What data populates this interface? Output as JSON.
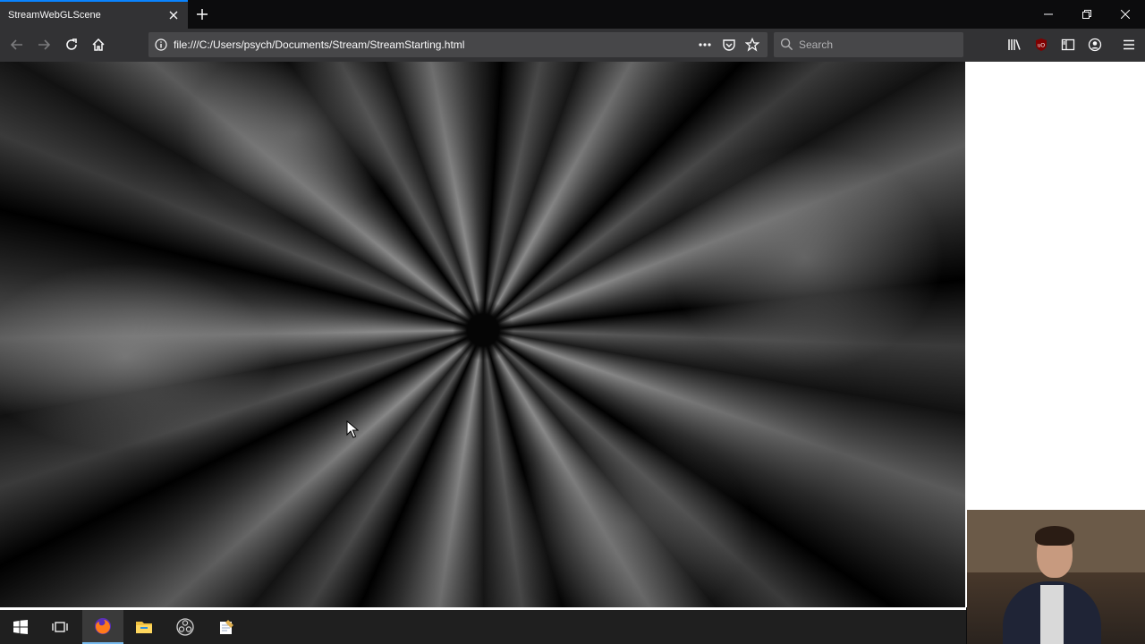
{
  "browser": {
    "tab": {
      "title": "StreamWebGLScene"
    },
    "url": "file:///C:/Users/psych/Documents/Stream/StreamStarting.html",
    "search": {
      "placeholder": "Search"
    }
  },
  "colors": {
    "accent": "#0a84ff",
    "toolbar": "#323234",
    "tabstrip": "#0c0c0d",
    "urlbar": "#474749",
    "taskbar": "#1f1f1f"
  },
  "toolbar_icons": [
    "back-icon",
    "forward-icon",
    "reload-icon",
    "home-icon",
    "info-icon",
    "page-actions-icon",
    "pocket-icon",
    "bookmark-star-icon",
    "search-icon",
    "library-icon",
    "ublock-icon",
    "sidebar-icon",
    "account-icon",
    "menu-icon"
  ],
  "taskbar_icons": [
    "windows-start-icon",
    "task-view-icon",
    "firefox-icon",
    "file-explorer-icon",
    "obs-icon",
    "notepad-icon"
  ]
}
